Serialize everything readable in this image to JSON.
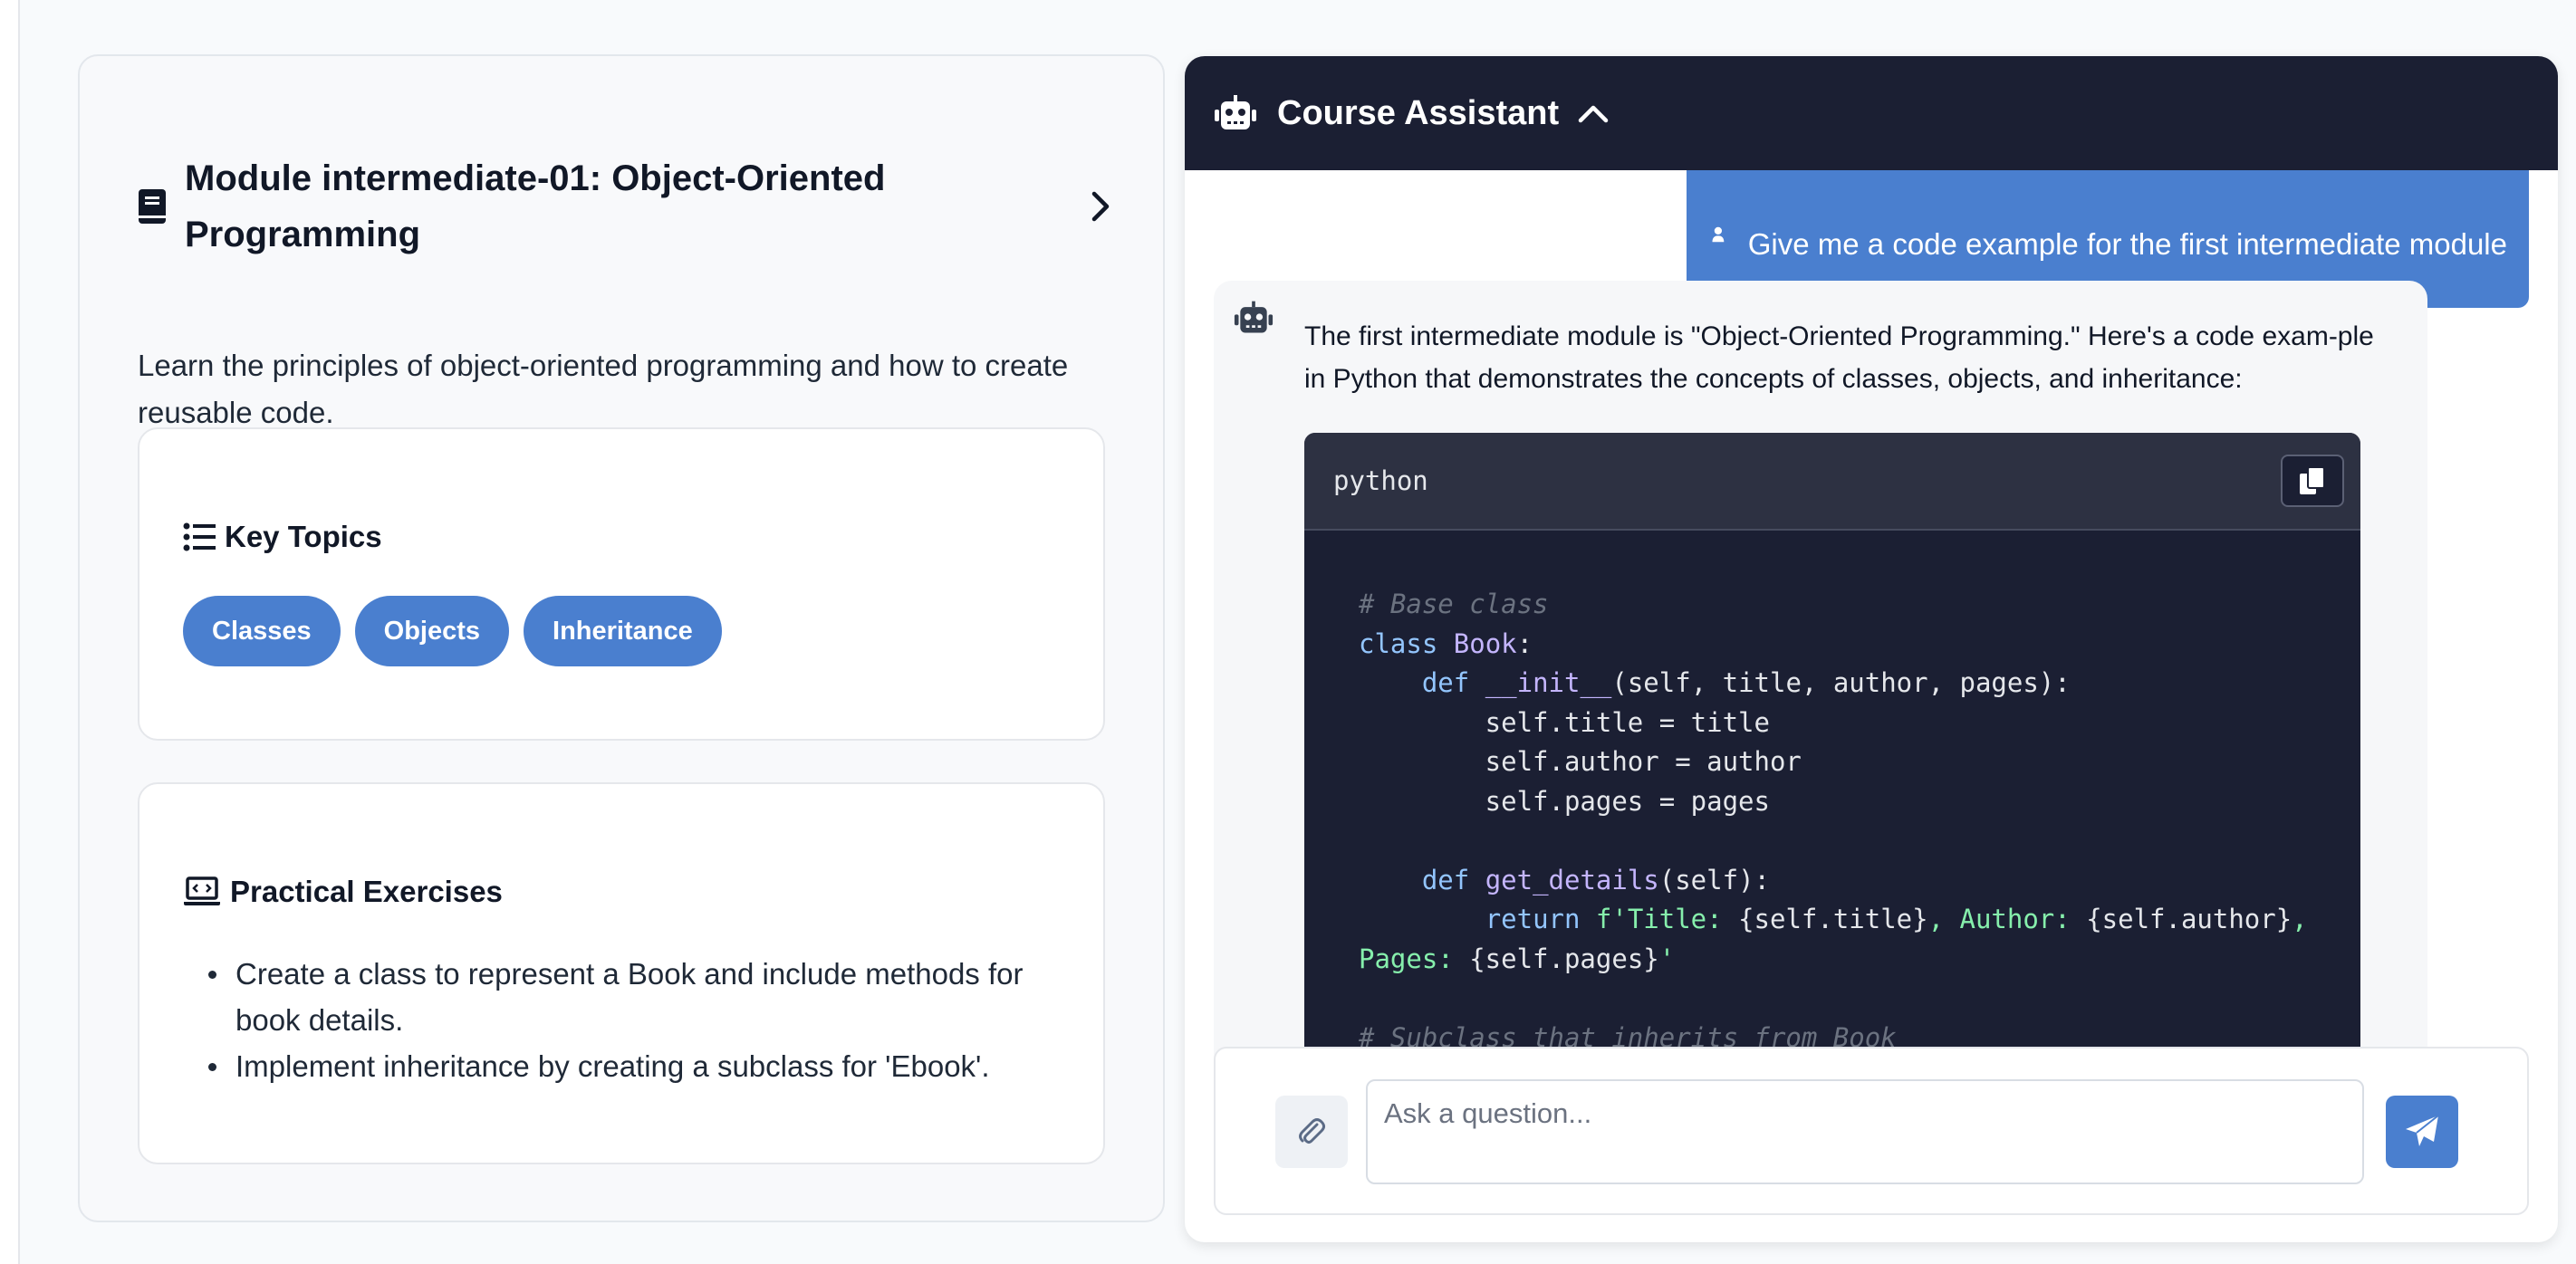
{
  "module": {
    "title": "Module intermediate-01: Object-Oriented Programming",
    "description": "Learn the principles of object-oriented programming and how to create reusable code.",
    "key_topics": {
      "title": "Key Topics",
      "chips": [
        "Classes",
        "Objects",
        "Inheritance"
      ]
    },
    "exercises": {
      "title": "Practical Exercises",
      "items": [
        "Create a class to represent a Book and include methods for book details.",
        "Implement inheritance by creating a subclass for 'Ebook'."
      ]
    }
  },
  "chat": {
    "title": "Course Assistant",
    "user_message": "Give me a code example for the first intermediate module",
    "bot_message": "The first intermediate module is \"Object-Oriented Programming.\" Here's a code exam-ple in Python that demonstrates the concepts of classes, objects, and inheritance:",
    "code_language": "python",
    "input_placeholder": "Ask a question..."
  },
  "colors": {
    "accent": "#4a7fcf",
    "chat_header": "#1b1f33",
    "code_bg": "#1b1f33"
  }
}
